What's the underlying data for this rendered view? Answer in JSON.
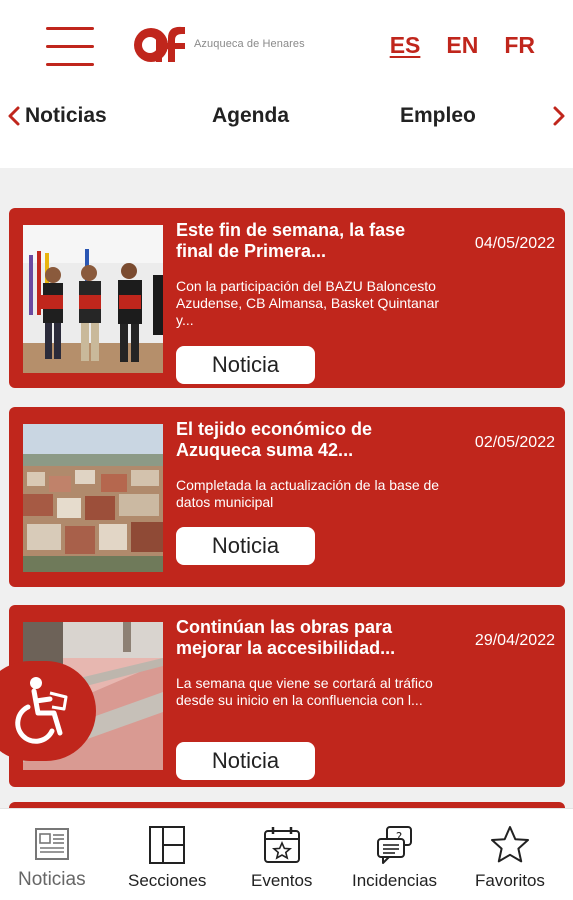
{
  "header": {
    "menu_icon": "hamburger-menu-icon",
    "logo_text": "Azuqueca de Henares",
    "languages": [
      "ES",
      "EN",
      "FR"
    ],
    "active_language": "ES",
    "brand_color": "#c0261c"
  },
  "tabs": {
    "prev_icon": "chevron-left-icon",
    "next_icon": "chevron-right-icon",
    "items": [
      "Noticias",
      "Agenda",
      "Empleo"
    ]
  },
  "news": [
    {
      "title": "Este fin de semana, la fase final de Primera...",
      "date": "04/05/2022",
      "summary": "Con la participación del BAZU Baloncesto Azudense, CB Almansa, Basket Quintanar y...",
      "badge": "Noticia"
    },
    {
      "title": "El tejido económico de Azuqueca suma 42...",
      "date": "02/05/2022",
      "summary": "Completada la actualización de la base de datos municipal",
      "badge": "Noticia"
    },
    {
      "title": "Continúan las obras para mejorar la accesibilidad...",
      "date": "29/04/2022",
      "summary": "La semana que viene se cortará al tráfico desde su inicio en la confluencia con l...",
      "badge": "Noticia"
    }
  ],
  "accessibility": {
    "icon": "accessibility-wheelchair-icon"
  },
  "bottom_nav": [
    {
      "label": "Noticias",
      "icon": "newspaper-icon",
      "active": true
    },
    {
      "label": "Secciones",
      "icon": "sections-layout-icon",
      "active": false
    },
    {
      "label": "Eventos",
      "icon": "calendar-star-icon",
      "active": false
    },
    {
      "label": "Incidencias",
      "icon": "report-chat-icon",
      "active": false
    },
    {
      "label": "Favoritos",
      "icon": "star-icon",
      "active": false
    }
  ]
}
